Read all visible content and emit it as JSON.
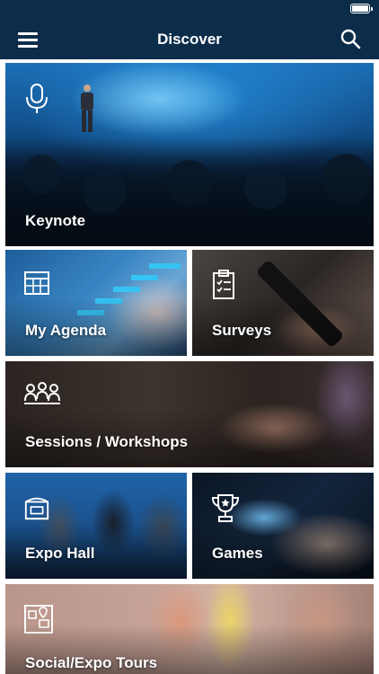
{
  "header": {
    "title": "Discover",
    "menu_icon": "hamburger-menu-icon",
    "search_icon": "search-icon"
  },
  "tiles": [
    {
      "id": "keynote",
      "label": "Keynote",
      "icon": "microphone-icon"
    },
    {
      "id": "agenda",
      "label": "My Agenda",
      "icon": "calendar-icon"
    },
    {
      "id": "surveys",
      "label": "Surveys",
      "icon": "clipboard-icon"
    },
    {
      "id": "sessions",
      "label": "Sessions / Workshops",
      "icon": "group-icon"
    },
    {
      "id": "expo",
      "label": "Expo Hall",
      "icon": "booth-icon"
    },
    {
      "id": "games",
      "label": "Games",
      "icon": "trophy-icon"
    },
    {
      "id": "social",
      "label": "Social/Expo Tours",
      "icon": "map-icon"
    }
  ],
  "colors": {
    "navbar": "#0c2d4a",
    "text": "#ffffff"
  }
}
